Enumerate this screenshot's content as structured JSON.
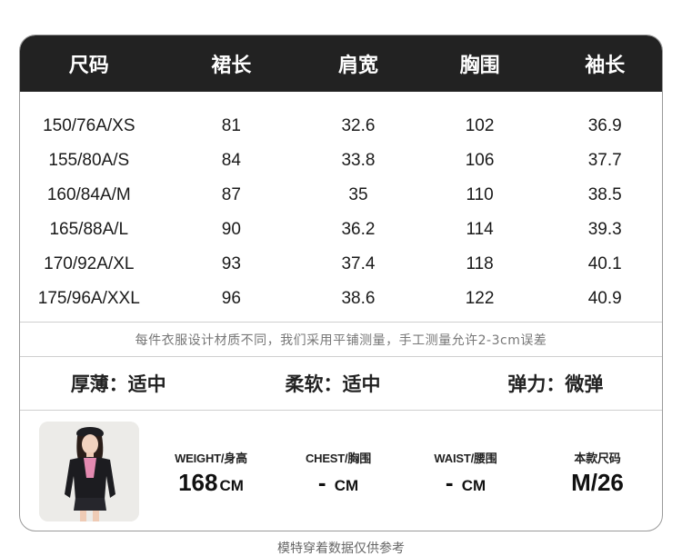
{
  "table": {
    "headers": [
      "尺码",
      "裙长",
      "肩宽",
      "胸围",
      "袖长"
    ],
    "rows": [
      [
        "150/76A/XS",
        "81",
        "32.6",
        "102",
        "36.9"
      ],
      [
        "155/80A/S",
        "84",
        "33.8",
        "106",
        "37.7"
      ],
      [
        "160/84A/M",
        "87",
        "35",
        "110",
        "38.5"
      ],
      [
        "165/88A/L",
        "90",
        "36.2",
        "114",
        "39.3"
      ],
      [
        "170/92A/XL",
        "93",
        "37.4",
        "118",
        "40.1"
      ],
      [
        "175/96A/XXL",
        "96",
        "38.6",
        "122",
        "40.9"
      ]
    ]
  },
  "note": "每件衣服设计材质不同，我们采用平铺测量，手工测量允许2-3cm误差",
  "properties": [
    "厚薄：适中",
    "柔软：适中",
    "弹力：微弹"
  ],
  "model": {
    "photo_icon": "model-photo",
    "weight": {
      "label": "WEIGHT/身高",
      "value": "168",
      "unit": "CM"
    },
    "chest": {
      "label": "CHEST/胸围",
      "value": "-",
      "unit": "CM"
    },
    "waist": {
      "label": "WAIST/腰围",
      "value": "-",
      "unit": "CM"
    },
    "size": {
      "label": "本款尺码",
      "value": "M/26"
    }
  },
  "footnote": "模特穿着数据仅供参考",
  "colors": {
    "header_bg": "#222222",
    "header_text": "#ffffff",
    "border": "#9a9a9a"
  }
}
